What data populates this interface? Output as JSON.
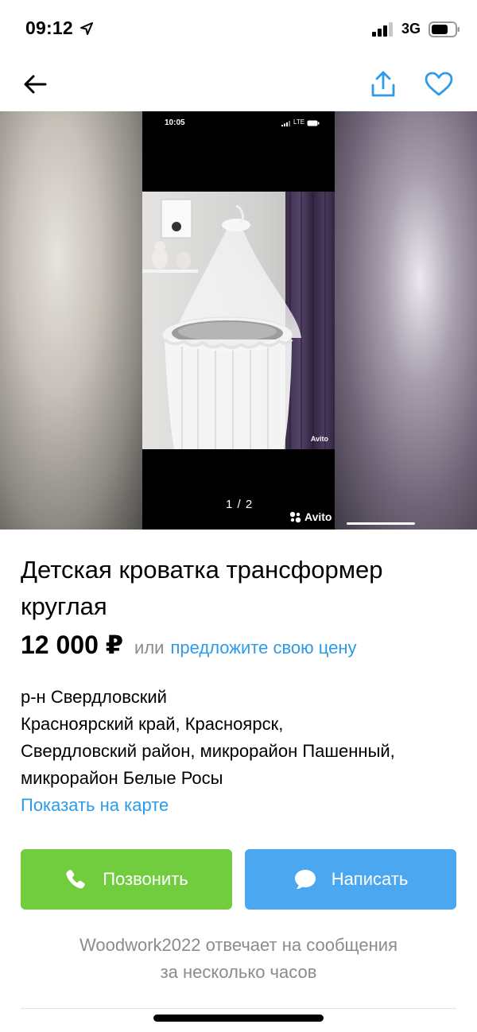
{
  "status_bar": {
    "time": "09:12",
    "network": "3G"
  },
  "nav": {
    "back_icon": "arrow-left-icon",
    "share_icon": "share-icon",
    "favorite_icon": "heart-icon",
    "accent_color": "#2e9be8"
  },
  "gallery": {
    "inner_status_time": "10:05",
    "inner_network": "LTE",
    "inner_watermark": "Avito",
    "counter": "1 / 2",
    "watermark": "Avito"
  },
  "listing": {
    "title": "Детская кроватка трансформер круглая",
    "price": "12 000 ₽",
    "price_or": "или",
    "offer_link": "предложите свою цену",
    "address_lines": [
      "р-н Свердловский",
      "Красноярский край, Красноярск,",
      "Свердловский район, микрорайон Пашенный,",
      "микрорайон Белые Росы"
    ],
    "map_link": "Показать на карте"
  },
  "actions": {
    "call_label": "Позвонить",
    "call_color": "#71cd3e",
    "message_label": "Написать",
    "message_color": "#4aa7f0"
  },
  "seller_note": {
    "line1": "Woodwork2022 отвечает на сообщения",
    "line2": "за несколько часов"
  }
}
